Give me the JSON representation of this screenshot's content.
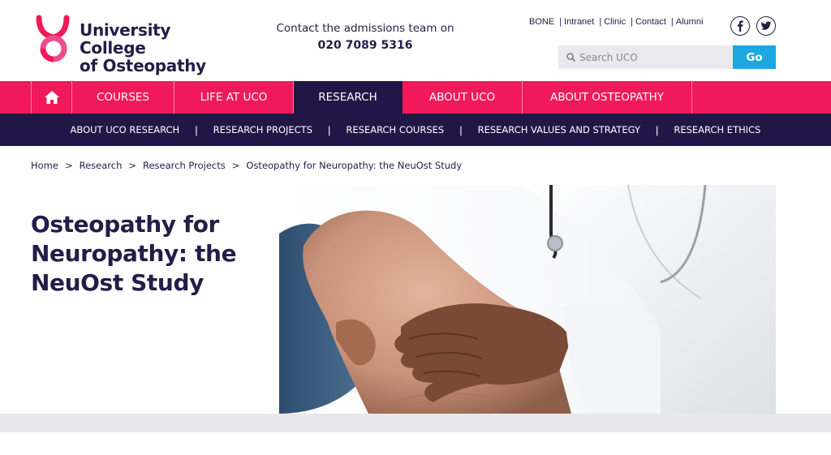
{
  "header": {
    "logo_line1": "University College",
    "logo_line2": "of Osteopathy",
    "contact_text": "Contact the admissions team on",
    "contact_phone": "020 7089 5316",
    "util_links": [
      "BONE",
      "Intranet",
      "Clinic",
      "Contact",
      "Alumni"
    ],
    "social": [
      "facebook-icon",
      "twitter-icon"
    ],
    "search_placeholder": "Search UCO",
    "search_button": "Go"
  },
  "primary_nav": {
    "items": [
      "COURSES",
      "LIFE AT UCO",
      "RESEARCH",
      "ABOUT UCO",
      "ABOUT OSTEOPATHY"
    ],
    "active": "RESEARCH"
  },
  "secondary_nav": {
    "items": [
      "ABOUT UCO RESEARCH",
      "RESEARCH PROJECTS",
      "RESEARCH COURSES",
      "RESEARCH VALUES AND STRATEGY",
      "RESEARCH ETHICS"
    ]
  },
  "breadcrumb": [
    "Home",
    "Research",
    "Research Projects",
    "Osteopathy for Neuropathy: the NeuOst Study"
  ],
  "page": {
    "title": "Osteopathy for Neuropathy: the NeuOst Study"
  },
  "colors": {
    "brand_pink": "#f2195a",
    "brand_navy": "#211746",
    "go_blue": "#1ba8e0"
  }
}
